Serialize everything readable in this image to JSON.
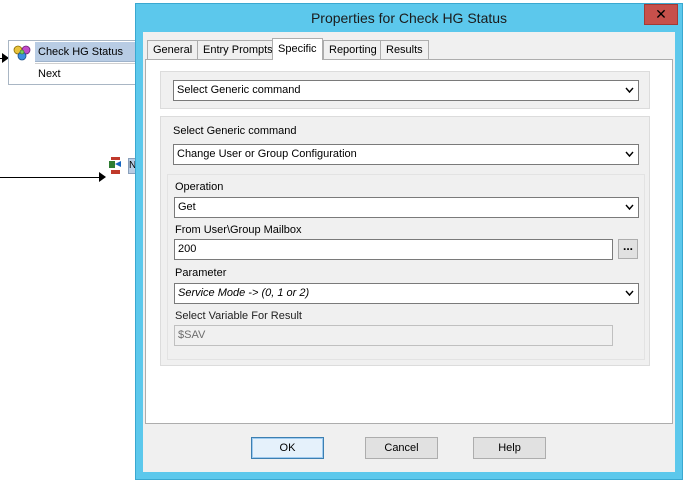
{
  "flowchart": {
    "node_title": "Check HG Status",
    "node_exit": "Next",
    "node_icon": "group-people-icon",
    "small_icon": "command-icon",
    "small_node_text": "N"
  },
  "dialog": {
    "title": "Properties for Check HG Status",
    "close_symbol": "✕",
    "tabs": [
      "General",
      "Entry Prompts",
      "Specific",
      "Reporting",
      "Results"
    ],
    "active_tab": "Specific",
    "top_combo_value": "Select Generic command",
    "generic_command_label": "Select Generic command",
    "generic_command_value": "Change User or Group Configuration",
    "operation_label": "Operation",
    "operation_value": "Get",
    "mailbox_label": "From User\\Group Mailbox",
    "mailbox_value": "200",
    "browse_label": "...",
    "parameter_label": "Parameter",
    "parameter_value": "Service Mode -> (0, 1 or 2)",
    "result_var_label": "Select Variable For Result",
    "result_var_value": "$SAV",
    "buttons": {
      "ok": "OK",
      "cancel": "Cancel",
      "help": "Help"
    }
  },
  "colors": {
    "window_frame": "#5cc8ec",
    "close_button": "#c7504b",
    "node_header": "#b8cce4"
  }
}
